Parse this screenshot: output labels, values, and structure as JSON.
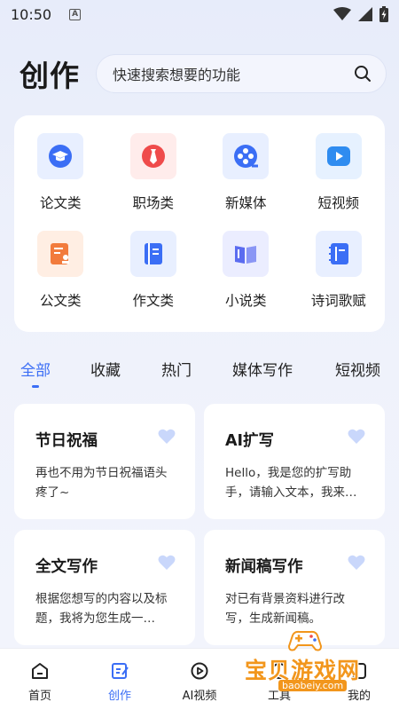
{
  "status_bar": {
    "time": "10:50",
    "app_glyph": "A"
  },
  "header": {
    "title": "创作",
    "search_placeholder": "快速搜索想要的功能"
  },
  "categories": [
    {
      "label": "论文类",
      "icon": "graduation-cap-icon",
      "color": "#3b6ef5",
      "bg": "#e8efff"
    },
    {
      "label": "职场类",
      "icon": "tie-icon",
      "color": "#ef4b4b",
      "bg": "#ffeceb"
    },
    {
      "label": "新媒体",
      "icon": "film-reel-icon",
      "color": "#3b6ef5",
      "bg": "#e8efff"
    },
    {
      "label": "短视频",
      "icon": "play-icon",
      "color": "#2f8cf0",
      "bg": "#e6f1ff"
    },
    {
      "label": "公文类",
      "icon": "document-stamp-icon",
      "color": "#f27b3c",
      "bg": "#ffeee3"
    },
    {
      "label": "作文类",
      "icon": "notebook-icon",
      "color": "#3b6ef5",
      "bg": "#e8efff"
    },
    {
      "label": "小说类",
      "icon": "open-book-icon",
      "color": "#5b6cf0",
      "bg": "#ebedff"
    },
    {
      "label": "诗词歌赋",
      "icon": "spiral-notebook-icon",
      "color": "#3b6ef5",
      "bg": "#e8efff"
    }
  ],
  "tabs": [
    {
      "label": "全部",
      "active": true
    },
    {
      "label": "收藏",
      "active": false
    },
    {
      "label": "热门",
      "active": false
    },
    {
      "label": "媒体写作",
      "active": false
    },
    {
      "label": "短视频",
      "active": false
    }
  ],
  "features": [
    {
      "title": "节日祝福",
      "desc": "再也不用为节日祝福语头疼了~"
    },
    {
      "title": "AI扩写",
      "desc": "Hello，我是您的扩写助手，请输入文本，我来…"
    },
    {
      "title": "全文写作",
      "desc": "根据您想写的内容以及标题，我将为您生成一…"
    },
    {
      "title": "新闻稿写作",
      "desc": "对已有背景资料进行改写，生成新闻稿。"
    }
  ],
  "bottom_nav": [
    {
      "label": "首页",
      "icon": "home-icon",
      "active": false
    },
    {
      "label": "创作",
      "icon": "edit-icon",
      "active": true
    },
    {
      "label": "AI视频",
      "icon": "play-circle-icon",
      "active": false
    },
    {
      "label": "工具",
      "icon": "tool-icon",
      "active": false
    },
    {
      "label": "我的",
      "icon": "profile-icon",
      "active": false
    }
  ],
  "watermark": {
    "title": "宝贝游戏网",
    "url": "baobeiy.com"
  },
  "colors": {
    "accent": "#3b6ef5",
    "heart": "#c9d7fb"
  }
}
